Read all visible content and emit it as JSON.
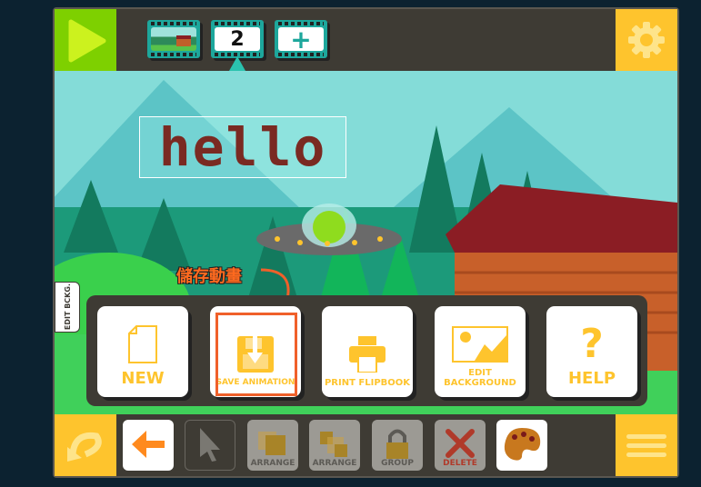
{
  "topbar": {
    "play_icon": "play-icon",
    "frames": [
      {
        "type": "thumbnail"
      },
      {
        "label": "2"
      },
      {
        "label": "+"
      }
    ],
    "settings_icon": "gear-icon"
  },
  "canvas": {
    "text_object": "hello",
    "edit_background_tab": "EDIT BCKG."
  },
  "annotation": {
    "callout": "儲存動畫",
    "color": "#f0602a"
  },
  "menu": {
    "items": [
      {
        "label": "NEW",
        "icon": "file-icon"
      },
      {
        "label": "SAVE ANIMATION",
        "icon": "floppy-download-icon"
      },
      {
        "label": "PRINT FLIPBOOK",
        "icon": "printer-icon"
      },
      {
        "label": "EDIT BACKGROUND",
        "icon": "image-icon"
      },
      {
        "label": "HELP",
        "icon": "question-icon"
      }
    ]
  },
  "toolbar": {
    "undo_icon": "undo-icon",
    "tools": [
      {
        "label": "",
        "icon": "arrow-left-icon"
      },
      {
        "label": "",
        "icon": "cursor-icon"
      },
      {
        "label": "ARRANGE",
        "icon": "arrange-front-icon"
      },
      {
        "label": "ARRANGE",
        "icon": "arrange-back-icon"
      },
      {
        "label": "GROUP",
        "icon": "lock-icon"
      },
      {
        "label": "DELETE",
        "icon": "x-icon"
      },
      {
        "label": "",
        "icon": "palette-icon"
      }
    ],
    "menu_icon": "hamburger-icon"
  },
  "colors": {
    "accent": "#fec42d",
    "play": "#7ed000",
    "film": "#1da79c",
    "bar": "#3e3b34"
  }
}
